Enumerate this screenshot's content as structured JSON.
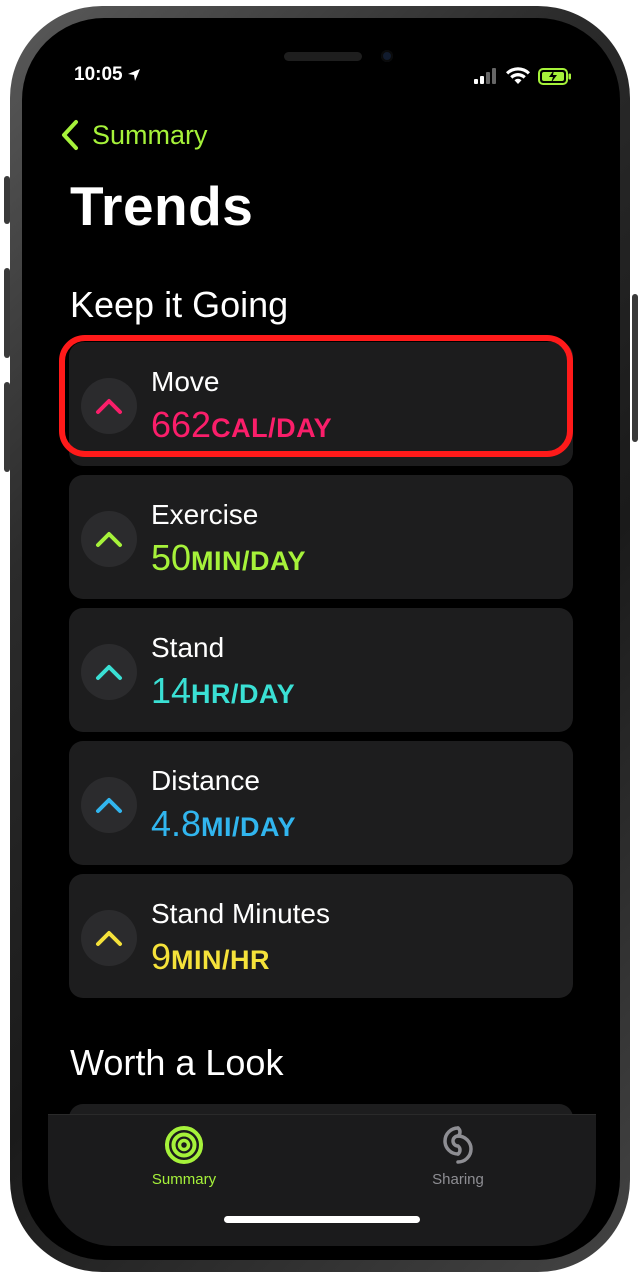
{
  "status_bar": {
    "time": "10:05"
  },
  "nav": {
    "back_label": "Summary",
    "title": "Trends"
  },
  "sections": {
    "keep_going": "Keep it Going",
    "worth_look": "Worth a Look"
  },
  "trends": [
    {
      "name": "Move",
      "value": "662",
      "unit": "CAL/DAY",
      "color": "#fa1e6a"
    },
    {
      "name": "Exercise",
      "value": "50",
      "unit": "MIN/DAY",
      "color": "#a6f23a"
    },
    {
      "name": "Stand",
      "value": "14",
      "unit": "HR/DAY",
      "color": "#3ae0d4"
    },
    {
      "name": "Distance",
      "value": "4.8",
      "unit": "MI/DAY",
      "color": "#31b5ee"
    },
    {
      "name": "Stand Minutes",
      "value": "9",
      "unit": "MIN/HR",
      "color": "#f5e23a"
    }
  ],
  "tab_bar": {
    "summary_label": "Summary",
    "sharing_label": "Sharing",
    "active_color": "#a6f23a",
    "inactive_color": "#8e8e93"
  },
  "icons": {
    "trend_arrow": "chevron-up-icon",
    "summary_tab": "activity-rings-icon",
    "sharing_tab": "sharing-icon"
  }
}
